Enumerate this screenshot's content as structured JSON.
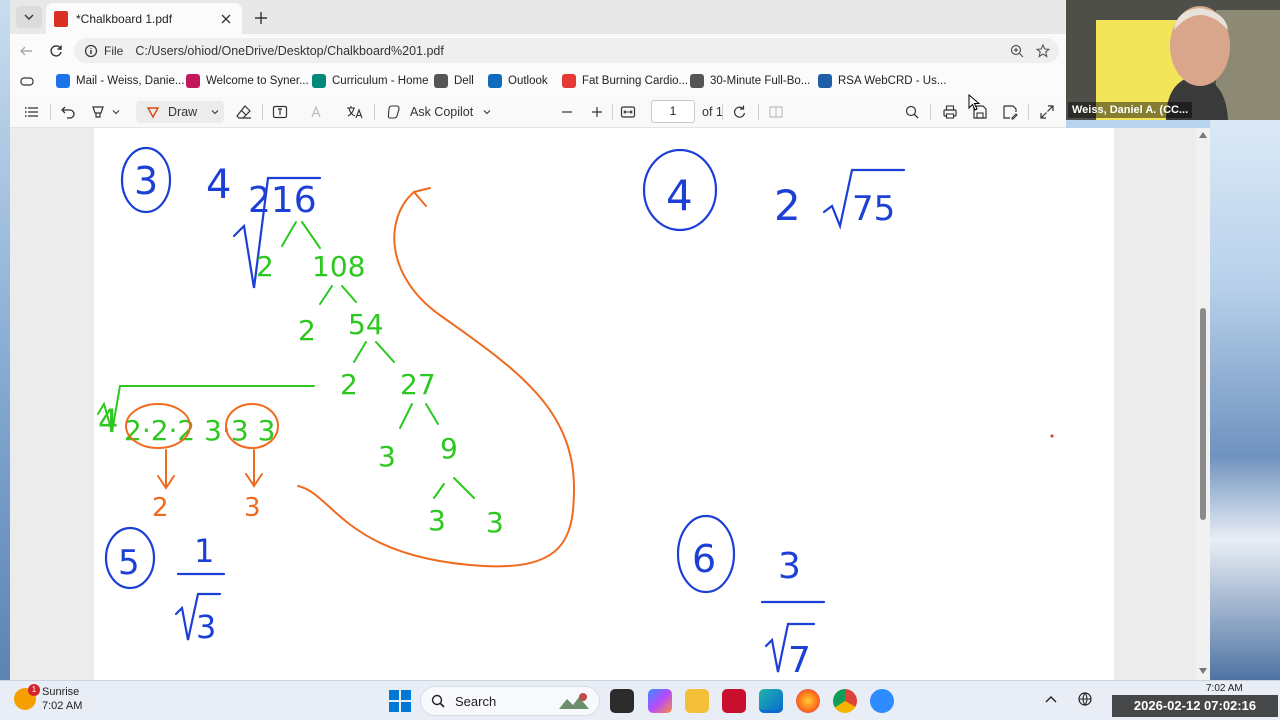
{
  "browser": {
    "tab_title": "*Chalkboard 1.pdf",
    "address_scheme": "File",
    "address_url": "C:/Users/ohiod/OneDrive/Desktop/Chalkboard%201.pdf",
    "favorites": [
      {
        "label": "Mail - Weiss, Danie...",
        "color": "#1a73e8"
      },
      {
        "label": "Welcome to Syner...",
        "color": "#c2185b"
      },
      {
        "label": "Curriculum - Home",
        "color": "#00897b"
      },
      {
        "label": "Dell",
        "color": "#555555"
      },
      {
        "label": "Outlook",
        "color": "#0f6cbd"
      },
      {
        "label": "Fat Burning Cardio...",
        "color": "#e53935"
      },
      {
        "label": "30-Minute Full-Bo...",
        "color": "#555555"
      },
      {
        "label": "RSA WebCRD - Us...",
        "color": "#1e5fa8"
      }
    ]
  },
  "pdf_toolbar": {
    "draw_label": "Draw",
    "copilot_label": "Ask Copilot",
    "page_number": "1",
    "page_total": "of 1"
  },
  "whiteboard": {
    "problem_3": {
      "number": "3",
      "coefficient": "4",
      "radicand": "216"
    },
    "tree_green": [
      "2",
      "108",
      "2",
      "54",
      "2",
      "27",
      "3",
      "9",
      "3",
      "3"
    ],
    "simplified": {
      "coefficient": "4",
      "expression": "2·2·2 3·3 3",
      "out_1": "2",
      "out_2": "3"
    },
    "problem_4": {
      "number": "4",
      "coefficient": "2",
      "radicand": "75"
    },
    "problem_5": {
      "number": "5",
      "numerator": "1",
      "radicand": "3"
    },
    "problem_6": {
      "number": "6",
      "numerator": "3",
      "radicand": "7"
    }
  },
  "webcam": {
    "name": "Weiss, Daniel A. (CC..."
  },
  "taskbar": {
    "weather_title": "Sunrise",
    "weather_time": "7:02 AM",
    "weather_badge": "1",
    "search_label": "Search",
    "clock_small": "7:02 AM",
    "datetime": "2026-02-12  07:02:16"
  }
}
